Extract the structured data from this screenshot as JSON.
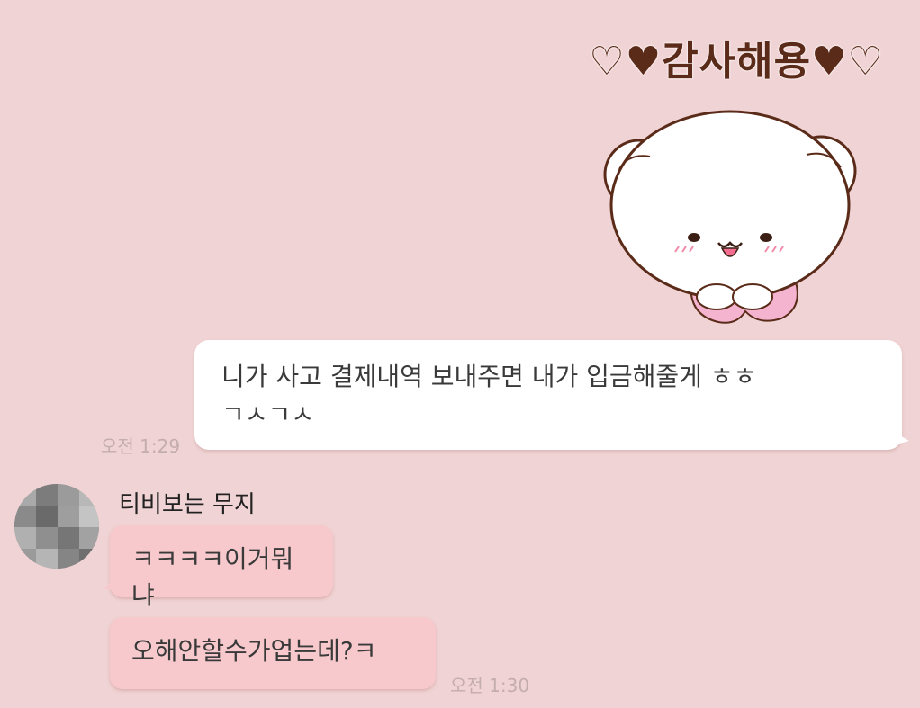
{
  "colors": {
    "background": "#f0d3d4",
    "my_bubble": "#ffffff",
    "other_bubble": "#f7c9cc",
    "timestamp": "#c4adad",
    "caption": "#5b2b19"
  },
  "sticker": {
    "caption": "♡♥감사해용♥♡",
    "icon": "white-bear-sticker"
  },
  "messages": {
    "mine": {
      "line1": "니가 사고 결제내역 보내주면 내가 입금해줄게 ㅎㅎ",
      "line2": "ㄱㅅㄱㅅ",
      "time": "오전 1:29"
    },
    "other": {
      "sender": "티비보는 무지",
      "bubble1": "ㅋㅋㅋㅋ이거뭐냐",
      "bubble2": "오해안할수가업는데?ㅋ",
      "time": "오전 1:30"
    }
  }
}
